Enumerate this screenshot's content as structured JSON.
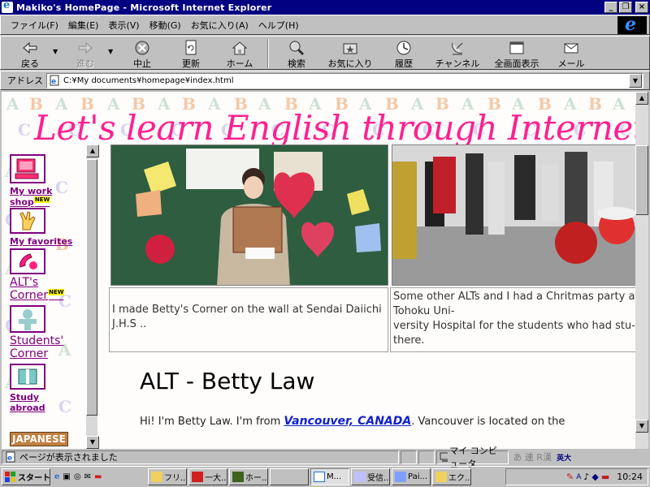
{
  "window": {
    "title": "Makiko's HomePage - Microsoft Internet Explorer",
    "buttons": [
      "_",
      "❐",
      "×"
    ]
  },
  "menu": [
    "ファイル(F)",
    "編集(E)",
    "表示(V)",
    "移動(G)",
    "お気に入り(A)",
    "ヘルプ(H)"
  ],
  "toolbar": {
    "back": "戻る",
    "forward": "進む",
    "stop": "中止",
    "refresh": "更新",
    "home": "ホーム",
    "search": "検索",
    "favorites": "お気に入り",
    "history": "履歴",
    "channels": "チャンネル",
    "fullscreen": "全画面表示",
    "mail": "メール"
  },
  "address": {
    "label": "アドレス",
    "value": "C:¥My documents¥homepage¥index.html"
  },
  "page": {
    "hero_title": "Let's learn English through Internet",
    "nav": [
      {
        "label_1": "My work",
        "label_2": "shop",
        "new": "NEW"
      },
      {
        "label_1": "My favorites"
      },
      {
        "label_1": "ALT's",
        "label_2": "Corner",
        "new": "NEW"
      },
      {
        "label_1": "Students'",
        "label_2": "Corner"
      },
      {
        "label_1": "Study",
        "label_2": "abroad"
      },
      {
        "label_1": "JAPANESE"
      }
    ],
    "caption_left": "I made Betty's Corner on the wall at Sendai Daiichi J.H.S ..",
    "caption_right_1": "Some other ALTs and I had a Chritmas party at",
    "caption_right_2": "Tohoku Uni-",
    "caption_right_3": "versity Hospital for the students who had stu-",
    "caption_right_4": "there.",
    "heading": "ALT - Betty Law",
    "intro_1": "Hi! I'm Betty Law. I'm from ",
    "intro_link": "Vancouver, CANADA",
    "intro_2": ". Vancouver is located on the"
  },
  "status": {
    "text": "ページが表示されました",
    "zone": "マイ コンピュータ"
  },
  "taskbar": {
    "start": "スタート",
    "tasks": [
      "フリ...",
      "一大...",
      "ホー...",
      "",
      "M...",
      "受信...",
      "Pai...",
      "エク..."
    ],
    "ime": "あ 連 R漢",
    "ime2": "英大",
    "clock": "10:24"
  },
  "colors": {
    "titlebar": "#000080",
    "hero": "#ff2090",
    "nav_link": "#800080",
    "link": "#1020d0"
  }
}
